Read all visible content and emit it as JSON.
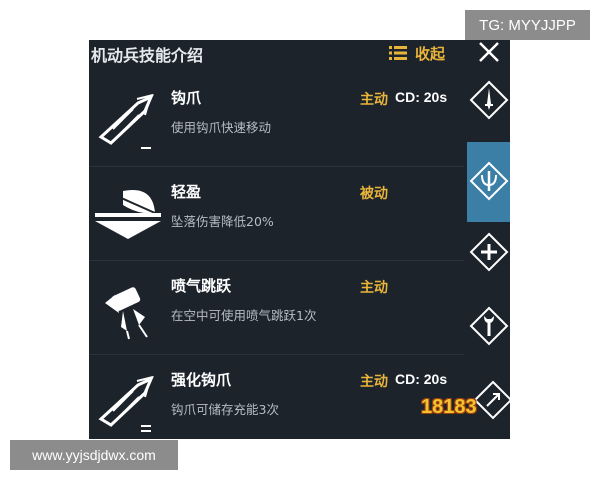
{
  "watermarks": {
    "tg": "TG: MYYJJPP",
    "url": "www.yyjsdjdwx.com"
  },
  "panel": {
    "title": "机动兵技能介绍",
    "collapse_label": "收起",
    "close_icon": "close-icon",
    "logo": "18183"
  },
  "skills": [
    {
      "name": "钩爪",
      "desc": "使用钩爪快速移动",
      "type": "主动",
      "cd": "CD: 20s",
      "icon": "grapple-hook-icon"
    },
    {
      "name": "轻盈",
      "desc": "坠落伤害降低20%",
      "type": "被动",
      "cd": "",
      "icon": "feather-icon"
    },
    {
      "name": "喷气跳跃",
      "desc": "在空中可使用喷气跳跃1次",
      "type": "主动",
      "cd": "",
      "icon": "jetpack-icon"
    },
    {
      "name": "强化钩爪",
      "desc": "钩爪可储存充能3次",
      "type": "主动",
      "cd": "CD: 20s",
      "icon": "grapple-hook-icon"
    }
  ],
  "side_tabs": [
    {
      "icon": "dagger-icon",
      "active": false
    },
    {
      "icon": "trident-icon",
      "active": true
    },
    {
      "icon": "plus-icon",
      "active": false
    },
    {
      "icon": "wrench-icon",
      "active": false
    },
    {
      "icon": "arrow-icon",
      "active": false
    }
  ],
  "colors": {
    "panel_bg": "#1c232b",
    "accent_gold": "#e8b43a",
    "active_tab": "#3b7fa6"
  }
}
